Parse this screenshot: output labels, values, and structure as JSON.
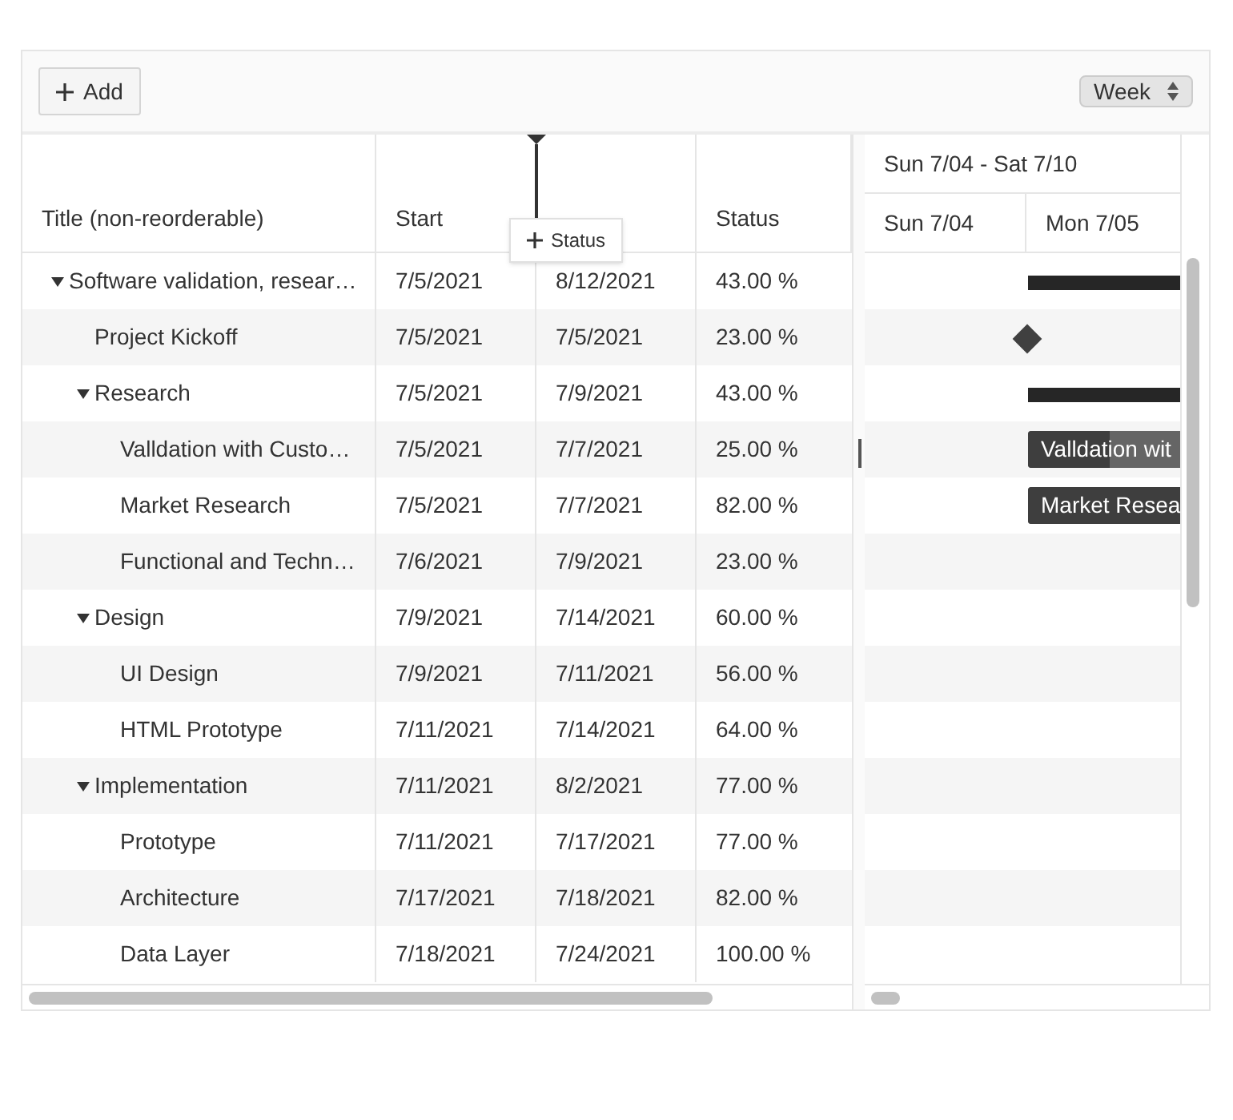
{
  "toolbar": {
    "add_button": "Add",
    "view_select": "Week"
  },
  "columns": [
    {
      "label": "Title (non-reorderable)"
    },
    {
      "label": "Start"
    },
    {},
    {
      "label": "Status"
    }
  ],
  "drag_cue": {
    "label": "Status"
  },
  "timeline": {
    "week": "Sun 7/04 - Sat 7/10",
    "days": [
      "Sun 7/04",
      "Mon 7/05"
    ]
  },
  "rows": [
    {
      "title": "Software validation, resear…",
      "start": "7/5/2021",
      "end": "8/12/2021",
      "status": "43.00 %",
      "expanded": true,
      "bar": {
        "kind": "summary"
      },
      "children": [
        {
          "title": "Project Kickoff",
          "start": "7/5/2021",
          "end": "7/5/2021",
          "status": "23.00 %",
          "bar": {
            "kind": "milestone"
          }
        },
        {
          "title": "Research",
          "start": "7/5/2021",
          "end": "7/9/2021",
          "status": "43.00 %",
          "expanded": true,
          "bar": {
            "kind": "summary"
          },
          "children": [
            {
              "title": "Valldation with Custo…",
              "start": "7/5/2021",
              "end": "7/7/2021",
              "status": "25.00 %",
              "bar": {
                "kind": "task",
                "label": "Valldation wit",
                "level": 0.25
              }
            },
            {
              "title": "Market Research",
              "start": "7/5/2021",
              "end": "7/7/2021",
              "status": "82.00 %",
              "bar": {
                "kind": "task",
                "label": "Market Resea",
                "level": 0.82
              }
            },
            {
              "title": "Functional and Techn…",
              "start": "7/6/2021",
              "end": "7/9/2021",
              "status": "23.00 %"
            }
          ]
        },
        {
          "title": "Design",
          "start": "7/9/2021",
          "end": "7/14/2021",
          "status": "60.00 %",
          "expanded": true,
          "children": [
            {
              "title": "UI Design",
              "start": "7/9/2021",
              "end": "7/11/2021",
              "status": "56.00 %"
            },
            {
              "title": "HTML Prototype",
              "start": "7/11/2021",
              "end": "7/14/2021",
              "status": "64.00 %"
            }
          ]
        },
        {
          "title": "Implementation",
          "start": "7/11/2021",
          "end": "8/2/2021",
          "status": "77.00 %",
          "expanded": true,
          "children": [
            {
              "title": "Prototype",
              "start": "7/11/2021",
              "end": "7/17/2021",
              "status": "77.00 %"
            },
            {
              "title": "Architecture",
              "start": "7/17/2021",
              "end": "7/18/2021",
              "status": "82.00 %"
            },
            {
              "title": "Data Layer",
              "start": "7/18/2021",
              "end": "7/24/2021",
              "status": "100.00 %"
            }
          ]
        }
      ]
    }
  ]
}
